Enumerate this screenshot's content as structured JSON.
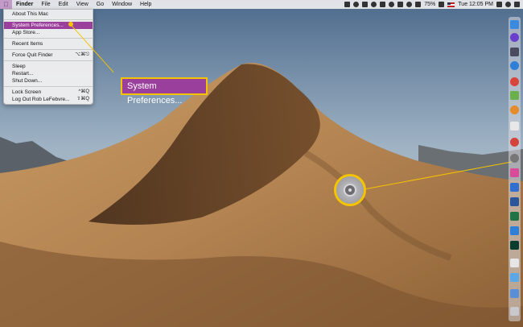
{
  "menubar": {
    "apple_icon": "apple-icon",
    "items": [
      "Finder",
      "File",
      "Edit",
      "View",
      "Go",
      "Window",
      "Help"
    ],
    "battery": "75%",
    "clock": "Tue 12:05 PM"
  },
  "apple_menu": {
    "items": [
      {
        "label": "About This Mac",
        "shortcut": ""
      },
      {
        "label": "System Preferences...",
        "shortcut": "",
        "highlighted": true
      },
      {
        "label": "App Store...",
        "shortcut": ""
      },
      {
        "label": "Recent Items",
        "shortcut": ""
      },
      {
        "label": "Force Quit Finder",
        "shortcut": "⌥⌘⎋"
      },
      {
        "label": "Sleep",
        "shortcut": ""
      },
      {
        "label": "Restart...",
        "shortcut": ""
      },
      {
        "label": "Shut Down...",
        "shortcut": ""
      },
      {
        "label": "Lock Screen",
        "shortcut": "^⌘Q"
      },
      {
        "label": "Log Out Rob LeFebvre...",
        "shortcut": "⇧⌘Q"
      }
    ]
  },
  "callout": {
    "label": "System Preferences...",
    "highlight_color": "#9b3f9c",
    "border_color": "#f5c400"
  },
  "dock_icons": [
    "finder-icon",
    "siri-icon",
    "launchpad-icon",
    "safari-icon",
    "chrome-icon",
    "maps-icon",
    "photos-icon",
    "messages-icon",
    "itunes-icon",
    "system-preferences-icon",
    "calendar-icon",
    "reminders-icon",
    "word-icon",
    "excel-icon",
    "powerpoint-icon",
    "photoshop-icon",
    "document-icon",
    "folder-icon",
    "downloads-icon",
    "trash-icon"
  ]
}
